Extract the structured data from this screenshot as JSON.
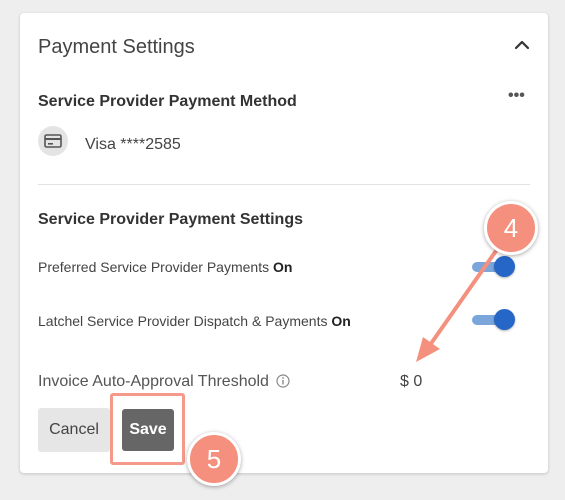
{
  "panel": {
    "title": "Payment Settings",
    "collapse_icon": "chevron-up-icon"
  },
  "payment_method": {
    "heading": "Service Provider Payment Method",
    "more_label": "•••",
    "card_icon": "credit-card-icon",
    "card_text": "Visa ****2585"
  },
  "payment_settings": {
    "heading": "Service Provider Payment Settings",
    "rows": [
      {
        "label": "Preferred Service Provider Payments ",
        "state": "On",
        "toggle_on": true
      },
      {
        "label": "Latchel Service Provider Dispatch & Payments ",
        "state": "On",
        "toggle_on": true
      }
    ],
    "threshold_label": "Invoice Auto-Approval Threshold",
    "threshold_info_icon": "info-icon",
    "threshold_value": "$ 0"
  },
  "actions": {
    "cancel_label": "Cancel",
    "save_label": "Save"
  },
  "annotations": {
    "step4": "4",
    "step5": "5",
    "color": "#f4907d"
  },
  "colors": {
    "toggle_track": "#7aa6dc",
    "toggle_knob": "#2566c7",
    "save_button": "#666666"
  }
}
